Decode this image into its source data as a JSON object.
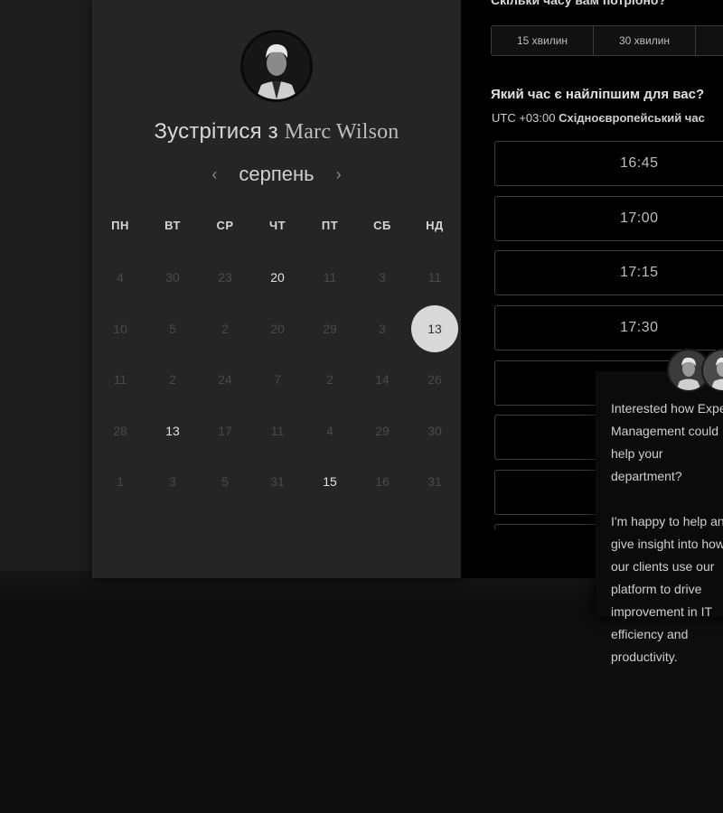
{
  "calendar": {
    "title_prefix": "Зустрітися з",
    "host_name": "Marc Wilson",
    "month": "серпень",
    "prev_arrow": "‹",
    "next_arrow": "›",
    "weekdays": [
      "ПН",
      "ВТ",
      "СР",
      "ЧТ",
      "ПТ",
      "СБ",
      "НД"
    ],
    "weeks": [
      [
        "4",
        "30",
        "23",
        "20",
        "11",
        "3",
        "11"
      ],
      [
        "10",
        "5",
        "2",
        "20",
        "29",
        "3",
        "13"
      ],
      [
        "11",
        "2",
        "24",
        "7",
        "2",
        "14",
        "26"
      ],
      [
        "28",
        "13",
        "17",
        "11",
        "4",
        "29",
        "30"
      ],
      [
        "1",
        "3",
        "5",
        "31",
        "15",
        "16",
        "31"
      ]
    ],
    "available": [
      [
        0,
        3
      ],
      [
        1,
        6
      ],
      [
        3,
        1
      ],
      [
        4,
        4
      ]
    ],
    "selected": [
      1,
      6
    ]
  },
  "scheduler": {
    "duration_question": "Скільки часу вам потрібно?",
    "durations": [
      "15 хвилин",
      "30 хвилин"
    ],
    "time_question": "Який час є найліпшим для вас?",
    "timezone_offset": "UTC +03:00",
    "timezone_name": "Східноєвропейський час",
    "slots": [
      "16:45",
      "17:00",
      "17:15",
      "17:30",
      "",
      "",
      "",
      ""
    ]
  },
  "chat": {
    "message": "Interested how Expert Management could help your department?\n\nI'm happy to help and give insight into how our clients use our platform to drive improvement in IT efficiency and productivity."
  },
  "colors": {
    "selected_day_bg": "#d9d9d9",
    "panel_bg": "#000000",
    "card_bg": "#252525"
  }
}
